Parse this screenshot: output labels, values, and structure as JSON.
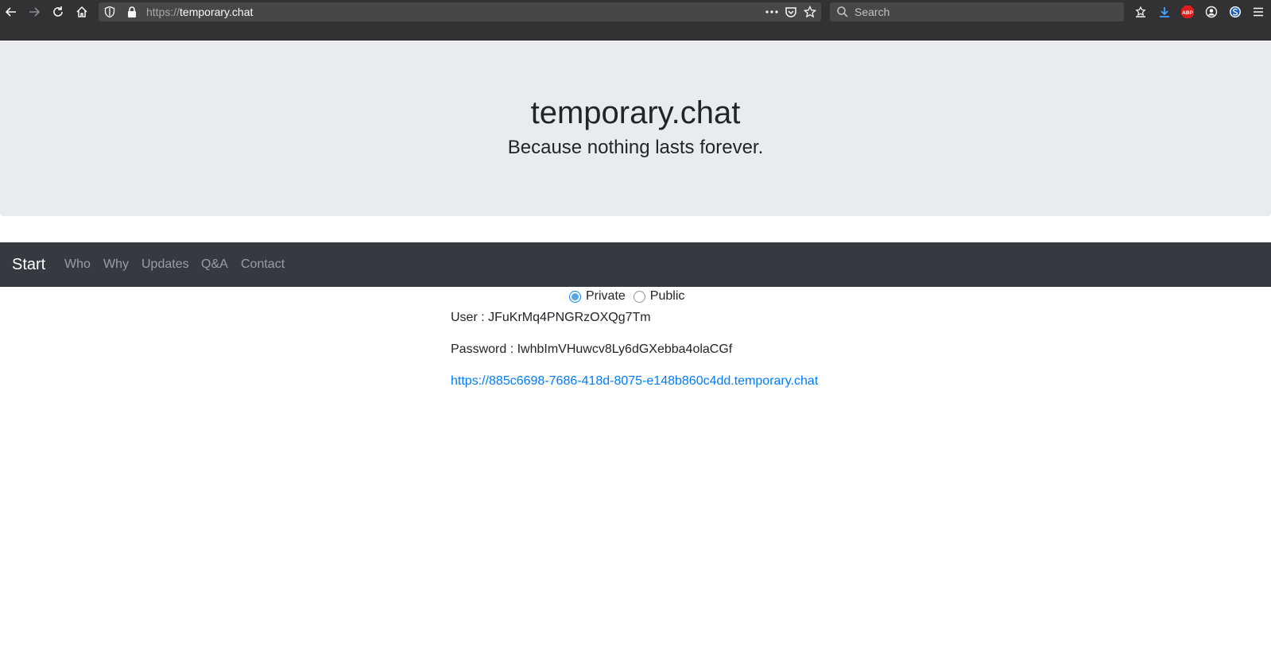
{
  "browser": {
    "url_protocol": "https://",
    "url_host": "temporary.chat",
    "search_placeholder": "Search",
    "adblock_label": "ABP"
  },
  "jumbotron": {
    "title": "temporary.chat",
    "tagline": "Because nothing lasts forever."
  },
  "navbar": {
    "brand": "Start",
    "links": [
      "Who",
      "Why",
      "Updates",
      "Q&A",
      "Contact"
    ]
  },
  "visibility": {
    "options": [
      "Private",
      "Public"
    ],
    "selected": "Private"
  },
  "credentials": {
    "user_line": "User : JFuKrMq4PNGRzOXQg7Tm",
    "password_line": "Password : IwhbImVHuwcv8Ly6dGXebba4olaCGf",
    "chat_url": "https://885c6698-7686-418d-8075-e148b860c4dd.temporary.chat"
  },
  "colors": {
    "jumbotron_bg": "#e9ecef",
    "navbar_bg": "#343a40",
    "link": "#007bff",
    "browser_chrome": "#323234"
  }
}
